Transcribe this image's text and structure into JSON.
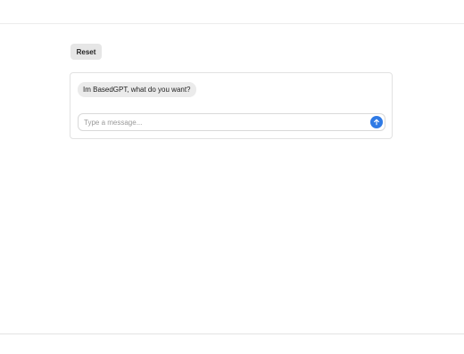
{
  "toolbar": {
    "reset_label": "Reset"
  },
  "chat": {
    "messages": [
      {
        "role": "assistant",
        "text": "Im BasedGPT, what do you want?"
      }
    ],
    "input": {
      "value": "",
      "placeholder": "Type a message..."
    },
    "send_icon": "arrow-up-icon"
  },
  "colors": {
    "accent": "#2f7ae5",
    "bubble_bg": "#ebebeb",
    "reset_bg": "#e6e6e6"
  }
}
